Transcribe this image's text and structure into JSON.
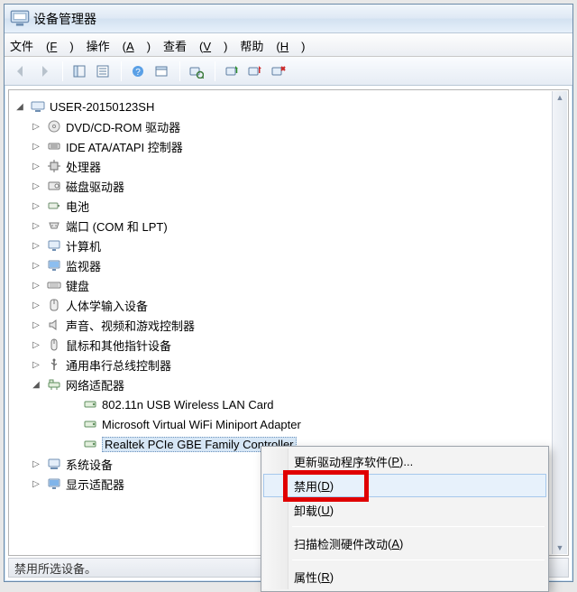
{
  "window": {
    "title": "设备管理器"
  },
  "menubar": {
    "file": {
      "text": "文件",
      "accel": "F"
    },
    "action": {
      "text": "操作",
      "accel": "A"
    },
    "view": {
      "text": "查看",
      "accel": "V"
    },
    "help": {
      "text": "帮助",
      "accel": "H"
    }
  },
  "tree": {
    "root": "USER-20150123SH",
    "items": {
      "dvd": "DVD/CD-ROM 驱动器",
      "ide": "IDE ATA/ATAPI 控制器",
      "cpu": "处理器",
      "disk": "磁盘驱动器",
      "battery": "电池",
      "ports": "端口 (COM 和 LPT)",
      "computer": "计算机",
      "monitor": "监视器",
      "keyboard": "键盘",
      "hid": "人体学输入设备",
      "sound": "声音、视频和游戏控制器",
      "mouse": "鼠标和其他指针设备",
      "usbctrl": "通用串行总线控制器",
      "network": "网络适配器",
      "netA": "802.11n USB Wireless LAN Card",
      "netB": "Microsoft Virtual WiFi Miniport Adapter",
      "netC": "Realtek PCIe GBE Family Controller",
      "system": "系统设备",
      "display": "显示适配器"
    }
  },
  "context_menu": {
    "update": {
      "text": "更新驱动程序软件",
      "accel": "P",
      "suffix": "..."
    },
    "disable": {
      "text": "禁用",
      "accel": "D"
    },
    "uninstall": {
      "text": "卸载",
      "accel": "U"
    },
    "scan": {
      "text": "扫描检测硬件改动",
      "accel": "A"
    },
    "props": {
      "text": "属性",
      "accel": "R"
    }
  },
  "statusbar": {
    "text": "禁用所选设备。"
  }
}
